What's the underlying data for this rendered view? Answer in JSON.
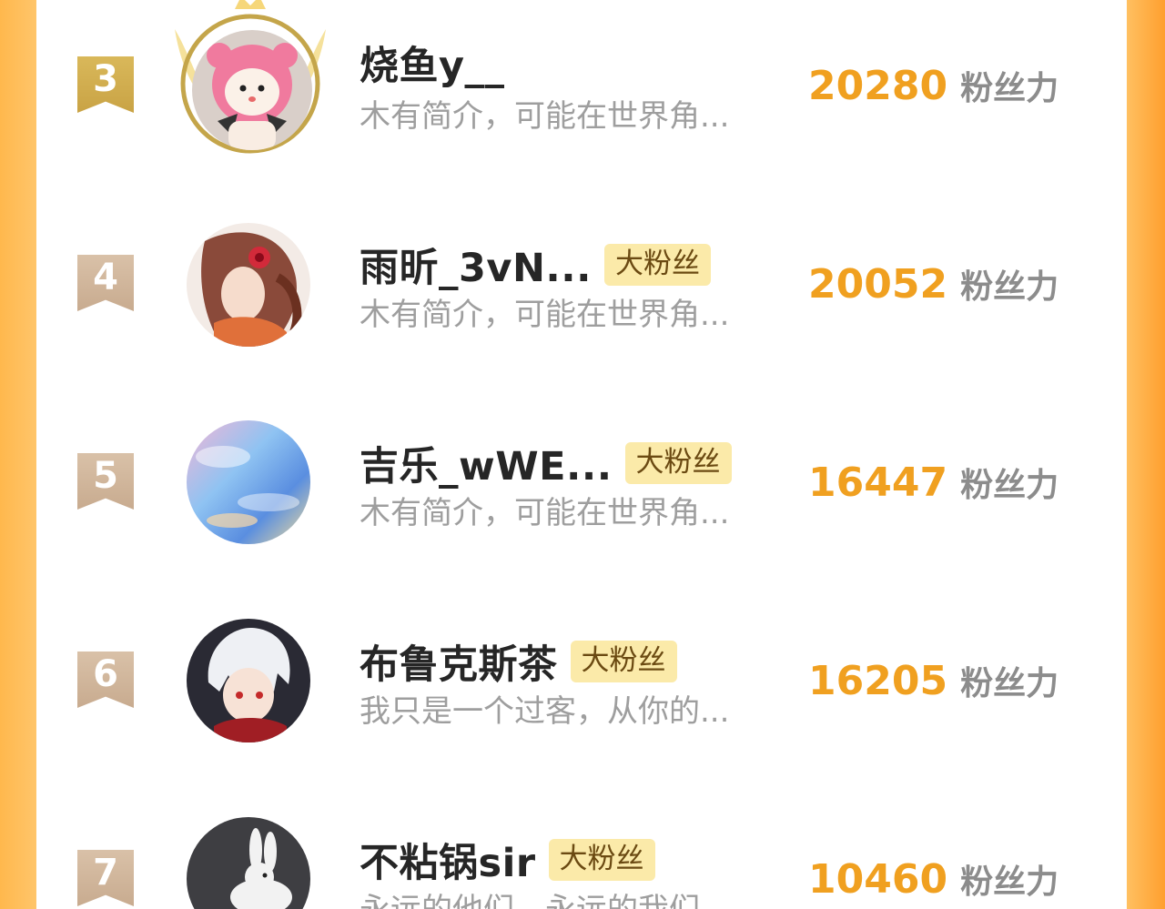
{
  "colors": {
    "accent_orange": "#f0a020",
    "badge_bg": "#fbeaa9",
    "gold_rank": "#d9b85a",
    "plain_rank": "#d9c1a8",
    "side_gradient": "#ff9f2e"
  },
  "leaderboard": [
    {
      "rank": "3",
      "name": "烧鱼y__",
      "badge": "",
      "bio": "木有简介，可能在世界角...",
      "score": "20280",
      "unit": "粉丝力",
      "avatar": "pink-bear-plush-avatar"
    },
    {
      "rank": "4",
      "name": "雨昕_3vN...",
      "badge": "大粉丝",
      "bio": "木有简介，可能在世界角...",
      "score": "20052",
      "unit": "粉丝力",
      "avatar": "anime-girl-rose-avatar"
    },
    {
      "rank": "5",
      "name": "吉乐_wWE...",
      "badge": "大粉丝",
      "bio": "木有简介，可能在世界角...",
      "score": "16447",
      "unit": "粉丝力",
      "avatar": "pastel-sky-avatar"
    },
    {
      "rank": "6",
      "name": "布鲁克斯茶",
      "badge": "大粉丝",
      "bio": "我只是一个过客，从你的...",
      "score": "16205",
      "unit": "粉丝力",
      "avatar": "white-hair-anime-boy-avatar"
    },
    {
      "rank": "7",
      "name": "不粘锅sir",
      "badge": "大粉丝",
      "bio": "永远的他们，永远的我们",
      "score": "10460",
      "unit": "粉丝力",
      "avatar": "white-rabbit-avatar"
    }
  ]
}
